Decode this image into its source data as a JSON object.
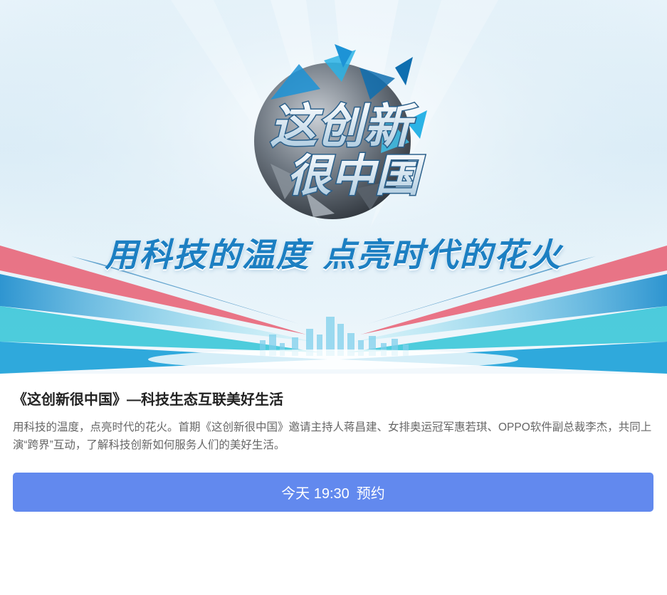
{
  "banner": {
    "logo_line1": "这创新",
    "logo_line2": "很中国",
    "slogan": "用科技的温度 点亮时代的花火",
    "colors": {
      "slogan": "#1c7fc2",
      "accent_red": "#e84a5f",
      "accent_teal": "#24c0d4",
      "accent_blue": "#1aa0d8"
    }
  },
  "article": {
    "title": "《这创新很中国》—科技生态互联美好生活",
    "description": "用科技的温度，点亮时代的花火。首期《这创新很中国》邀请主持人蒋昌建、女排奥运冠军惠若琪、OPPO软件副总裁李杰，共同上演“跨界”互动，了解科技创新如何服务人们的美好生活。"
  },
  "reserve_button": {
    "time": "今天 19:30",
    "label": "预约",
    "color": "#6289ee"
  }
}
